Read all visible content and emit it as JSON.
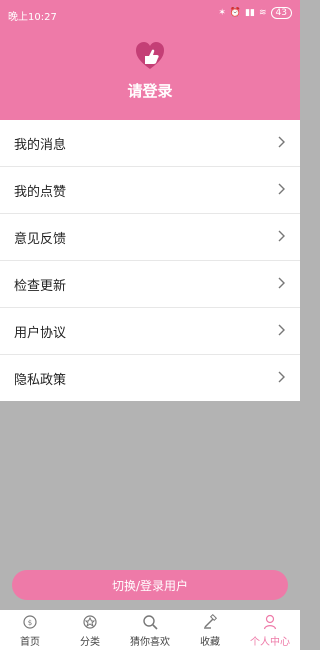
{
  "status_bar": {
    "time": "晚上10:27",
    "battery": "43"
  },
  "header": {
    "login_prompt": "请登录",
    "accent_color": "#ee7aa8"
  },
  "menu": {
    "items": [
      {
        "label": "我的消息"
      },
      {
        "label": "我的点赞"
      },
      {
        "label": "意见反馈"
      },
      {
        "label": "检查更新"
      },
      {
        "label": "用户协议"
      },
      {
        "label": "隐私政策"
      }
    ]
  },
  "switch_button": {
    "label": "切换/登录用户"
  },
  "tabbar": {
    "tabs": [
      {
        "label": "首页",
        "icon": "home-icon"
      },
      {
        "label": "分类",
        "icon": "category-icon"
      },
      {
        "label": "猜你喜欢",
        "icon": "search-icon"
      },
      {
        "label": "收藏",
        "icon": "favorite-icon"
      },
      {
        "label": "个人中心",
        "icon": "user-icon"
      }
    ]
  }
}
